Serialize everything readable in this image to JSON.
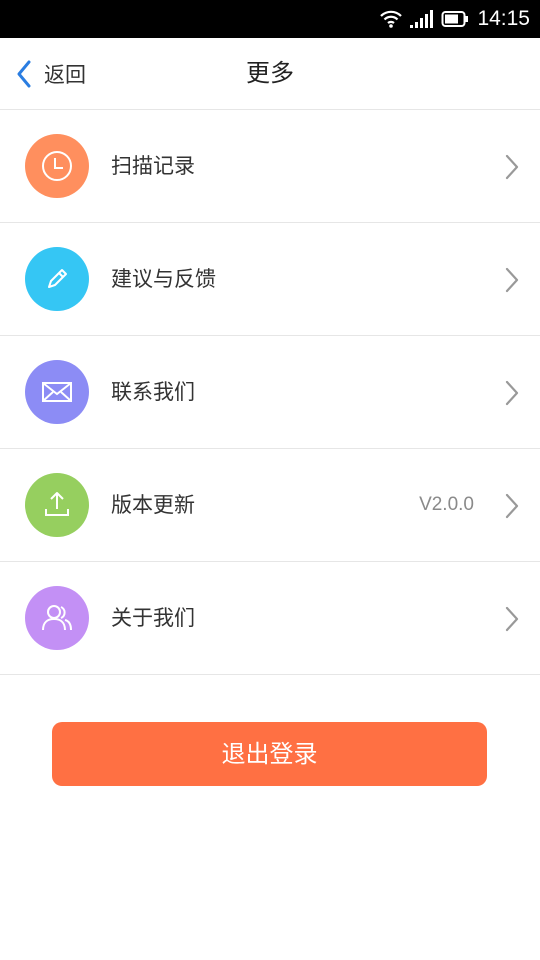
{
  "status_bar": {
    "time": "14:15",
    "icons": [
      "wifi-icon",
      "cellular-signal-icon",
      "battery-icon"
    ]
  },
  "header": {
    "back_label": "返回",
    "title": "更多"
  },
  "menu": {
    "items": [
      {
        "label": "扫描记录",
        "icon": "clock-icon",
        "color": "#ff8f5e"
      },
      {
        "label": "建议与反馈",
        "icon": "pencil-icon",
        "color": "#35c6f4"
      },
      {
        "label": "联系我们",
        "icon": "envelope-icon",
        "color": "#8c8cf5"
      },
      {
        "label": "版本更新",
        "icon": "upload-icon",
        "color": "#96cf5f",
        "value": "V2.0.0"
      },
      {
        "label": "关于我们",
        "icon": "users-icon",
        "color": "#c390f5"
      }
    ]
  },
  "logout": {
    "label": "退出登录",
    "color": "#ff7043"
  },
  "colors": {
    "back_chevron": "#2a7de1",
    "chevron": "#999999",
    "divider": "#e6e6e6"
  }
}
